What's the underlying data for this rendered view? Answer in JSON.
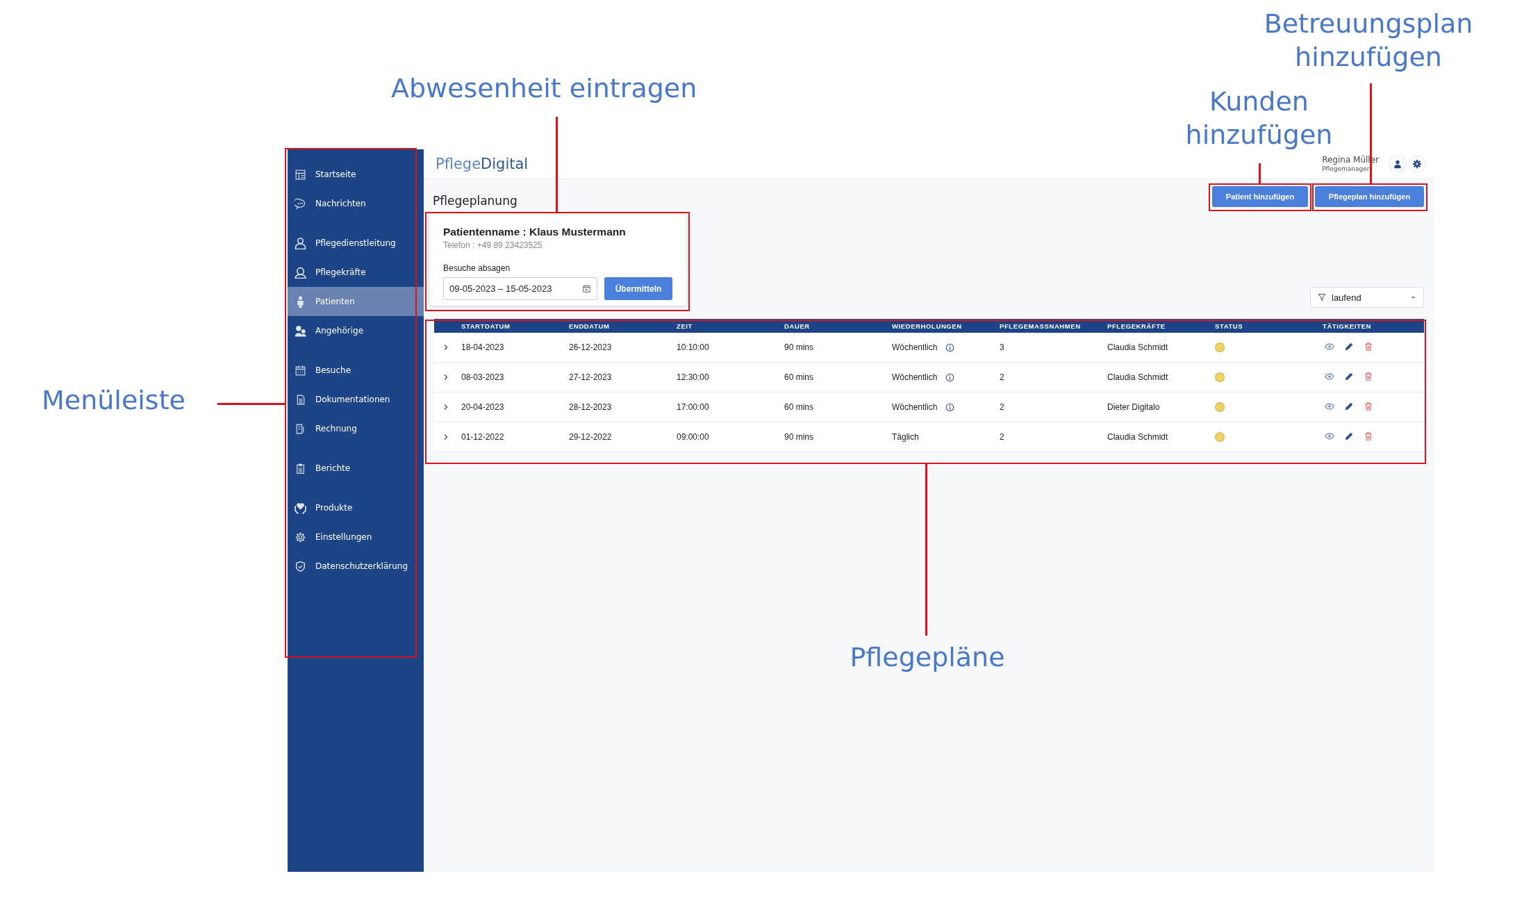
{
  "annotations": [
    {
      "text": "Abwesenheit eintragen"
    },
    {
      "text": "Betreuungsplan\nhinzufügen"
    },
    {
      "text": "Kunden\nhinzufügen"
    },
    {
      "text": "Menüleiste"
    },
    {
      "text": "Pflegepläne"
    }
  ],
  "app": {
    "logo": {
      "part_1": "Pflege",
      "part_2": "Digital"
    },
    "user": {
      "name": "Regina Müller",
      "role": "Pflegemanager"
    },
    "sidebar": {
      "groups": [
        {
          "items": [
            {
              "label": "Startseite",
              "selected": false
            },
            {
              "label": "Nachrichten",
              "selected": false
            }
          ]
        },
        {
          "items": [
            {
              "label": "Pflegedienstleitung",
              "selected": false
            },
            {
              "label": "Pflegekräfte",
              "selected": false
            },
            {
              "label": "Patienten",
              "selected": true
            },
            {
              "label": "Angehörige",
              "selected": false
            }
          ]
        },
        {
          "items": [
            {
              "label": "Besuche",
              "selected": false
            },
            {
              "label": "Dokumentationen",
              "selected": false
            },
            {
              "label": "Rechnung",
              "selected": false
            }
          ]
        },
        {
          "items": [
            {
              "label": "Berichte",
              "selected": false
            }
          ]
        },
        {
          "items": [
            {
              "label": "Produkte",
              "selected": false
            },
            {
              "label": "Einstellungen",
              "selected": false
            },
            {
              "label": "Datenschutzerklärung",
              "selected": false
            }
          ]
        }
      ]
    },
    "page_title": "Pflegeplanung",
    "buttons": [
      "Patient hinzufügen",
      "Pflegeplan hinzufügen"
    ],
    "patient_card": {
      "name_line": "Patientenname : Klaus Mustermann",
      "phone": "Telefon : +49 89 23423525",
      "cancel_label": "Besuche absagen",
      "date_range": "09-05-2023 – 15-05-2023",
      "submit": "Übermitteln"
    },
    "filter": {
      "value": "laufend"
    },
    "table": {
      "columns": [
        "STARTDATUM",
        "ENDDATUM",
        "ZEIT",
        "DAUER",
        "WIEDERHOLUNGEN",
        "PFLEGEMASSNAHMEN",
        "PFLEGEKRÄFTE",
        "STATUS",
        "TÄTIGKEITEN"
      ],
      "rows": [
        {
          "expanded": false,
          "cells": [
            "18-04-2023",
            "26-12-2023",
            "10:10:00",
            "90 mins",
            "Wöchentlich",
            "3",
            "Claudia Schmidt"
          ],
          "repeat_info": true,
          "color": "#f0d264"
        },
        {
          "expanded": false,
          "cells": [
            "08-03-2023",
            "27-12-2023",
            "12:30:00",
            "60 mins",
            "Wöchentlich",
            "2",
            "Claudia Schmidt"
          ],
          "repeat_info": true,
          "color": "#f0d264"
        },
        {
          "expanded": false,
          "cells": [
            "20-04-2023",
            "28-12-2023",
            "17:00:00",
            "60 mins",
            "Wöchentlich",
            "2",
            "Dieter Digitalo"
          ],
          "repeat_info": true,
          "color": "#f0d264"
        },
        {
          "expanded": false,
          "cells": [
            "01-12-2022",
            "29-12-2022",
            "09:00:00",
            "90 mins",
            "Täglich",
            "2",
            "Claudia Schmidt"
          ],
          "repeat_info": false,
          "color": "#f0d264"
        }
      ]
    }
  }
}
